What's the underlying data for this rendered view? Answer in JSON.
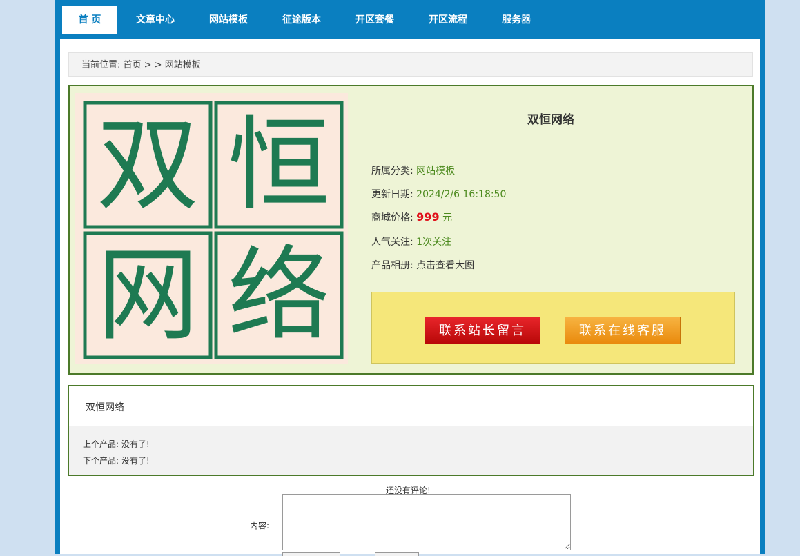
{
  "nav": {
    "items": [
      {
        "label": "首 页",
        "active": true
      },
      {
        "label": "文章中心"
      },
      {
        "label": "网站模板"
      },
      {
        "label": "征途版本"
      },
      {
        "label": "开区套餐"
      },
      {
        "label": "开区流程"
      },
      {
        "label": "服务器"
      }
    ]
  },
  "breadcrumb": {
    "text": "当前位置: 首页 > > 网站模板"
  },
  "product": {
    "logo_text": [
      "双",
      "恒",
      "网",
      "络"
    ],
    "title": "双恒网络",
    "category_label": "所属分类:",
    "category_value": "网站模板",
    "date_label": "更新日期:",
    "date_value": "2024/2/6 16:18:50",
    "price_label": "商城价格:",
    "price_value": "999",
    "price_unit": "元",
    "popularity_label": "人气关注:",
    "popularity_value": "1次关注",
    "album_label": "产品相册:",
    "album_value": "点击查看大图",
    "button_message": "联系站长留言",
    "button_service": "联系在线客服"
  },
  "description": {
    "title": "双恒网络",
    "prev": "上个产品: 没有了!",
    "next": "下个产品: 没有了!"
  },
  "comments": {
    "empty_text": "还没有评论!",
    "content_label": "内容:",
    "content_value": ""
  },
  "colors": {
    "brand_blue": "#0a7fc0",
    "product_bg": "#eef4d6",
    "price_red": "#e0101a",
    "logo_green": "#1e7a52"
  }
}
